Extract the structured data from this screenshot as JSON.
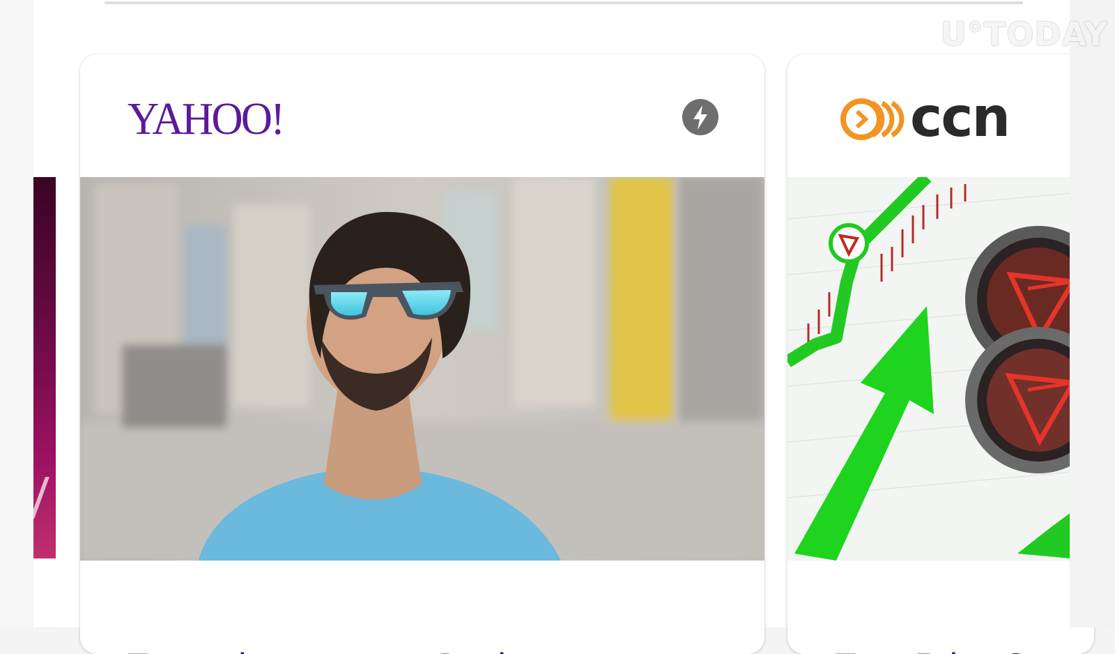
{
  "colors": {
    "yahoo_purple": "#5b1a9a",
    "link_blue": "#1a0dab",
    "amp_gray": "#6e6e6e",
    "ccn_orange": "#f29422",
    "ccn_dark": "#2a2a2a",
    "chart_green": "#22c922",
    "tron_red": "#c4261d"
  },
  "watermark": "U°TODAY",
  "cards": [
    {
      "publisher": "YAHOO!",
      "icon": "amp-lightning-icon",
      "image": "man-with-sunglasses-looking-up-photo",
      "headline": "Tron price soars as Justin"
    },
    {
      "publisher": "ccn",
      "icon": "ccn-logo-icon",
      "image": "tron-coins-green-arrow-chart-image",
      "headline": "Tron Price Sc"
    }
  ]
}
